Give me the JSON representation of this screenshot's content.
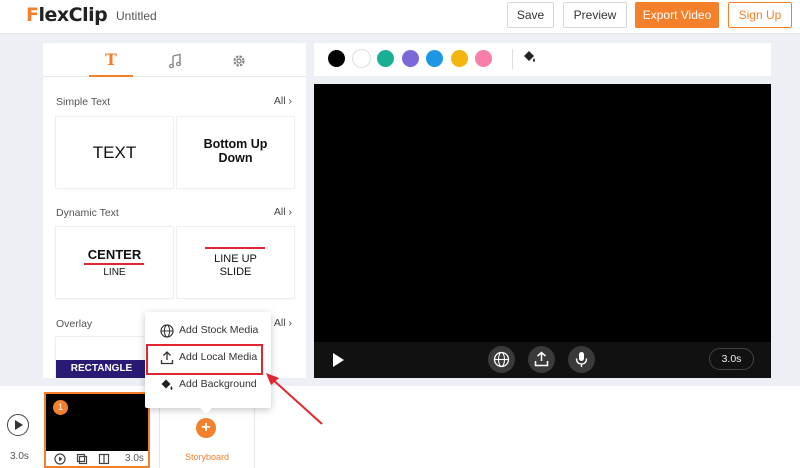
{
  "header": {
    "logo": "FlexClip",
    "doc_title": "Untitled",
    "save_label": "Save",
    "preview_label": "Preview",
    "export_label": "Export Video",
    "signup_label": "Sign Up"
  },
  "tabs": [
    {
      "icon": "text-tab-icon",
      "glyph": "T",
      "active": true
    },
    {
      "icon": "music-icon",
      "glyph": "♫"
    },
    {
      "icon": "gear-icon",
      "glyph": "⚙"
    }
  ],
  "sections": {
    "simple_text": {
      "title": "Simple Text",
      "all": "All",
      "cards": [
        "TEXT",
        "Bottom Up Down"
      ]
    },
    "dynamic_text": {
      "title": "Dynamic Text",
      "all": "All",
      "cards": [
        {
          "line1": "CENTER",
          "line2": "LINE"
        },
        {
          "line1": "LINE UP",
          "line2": "SLIDE"
        }
      ]
    },
    "overlay": {
      "title": "Overlay",
      "all": "All",
      "card": "RECTANGLE"
    }
  },
  "colors": [
    "#000000",
    "#ffffff",
    "#1aaf94",
    "#7b68d9",
    "#1e96e6",
    "#f4b50e",
    "#f77faa"
  ],
  "preview": {
    "time": "3.0s"
  },
  "timeline": {
    "duration": "3.0s",
    "clip_number": "1",
    "clip_time": "3.0s",
    "storyboard_label": "Storyboard"
  },
  "menu": {
    "items": [
      {
        "label": "Add Stock Media",
        "icon": "globe-icon"
      },
      {
        "label": "Add Local Media",
        "icon": "upload-icon",
        "highlighted": true
      },
      {
        "label": "Add Background",
        "icon": "paint-bucket-icon"
      }
    ]
  },
  "accent_color": "#f5802b",
  "highlight_color": "#e0262f"
}
